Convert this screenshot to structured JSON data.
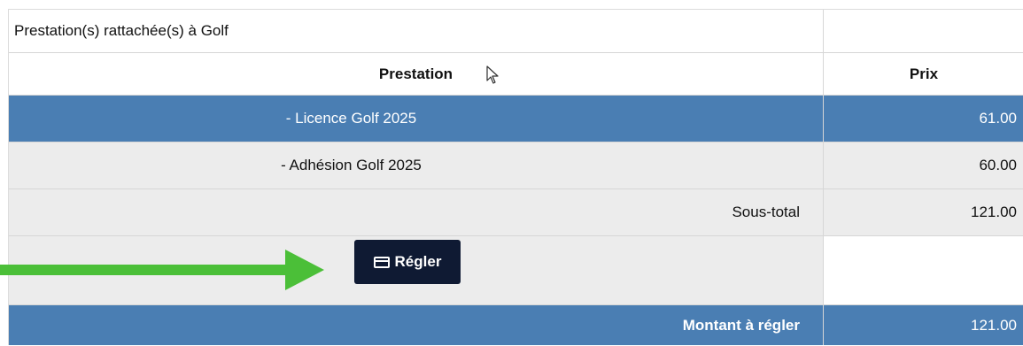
{
  "table": {
    "title": "Prestation(s) rattachée(s) à Golf",
    "headers": {
      "prestation": "Prestation",
      "prix": "Prix"
    },
    "items": [
      {
        "label": "- Licence Golf 2025",
        "price": "61.00"
      },
      {
        "label": "- Adhésion Golf 2025",
        "price": "60.00"
      }
    ],
    "subtotal": {
      "label": "Sous-total",
      "value": "121.00"
    },
    "pay_button": {
      "icon": "credit-card-icon",
      "label": "Régler"
    },
    "total": {
      "label": "Montant à régler",
      "value": "121.00"
    }
  },
  "colors": {
    "row_highlight": "#4a7eb3",
    "row_alt": "#ececec",
    "button_bg": "#0f1a33",
    "arrow": "#4bbf38"
  },
  "annotations": {
    "arrow": "green-arrow-icon",
    "cursor": "mouse-cursor-icon"
  }
}
